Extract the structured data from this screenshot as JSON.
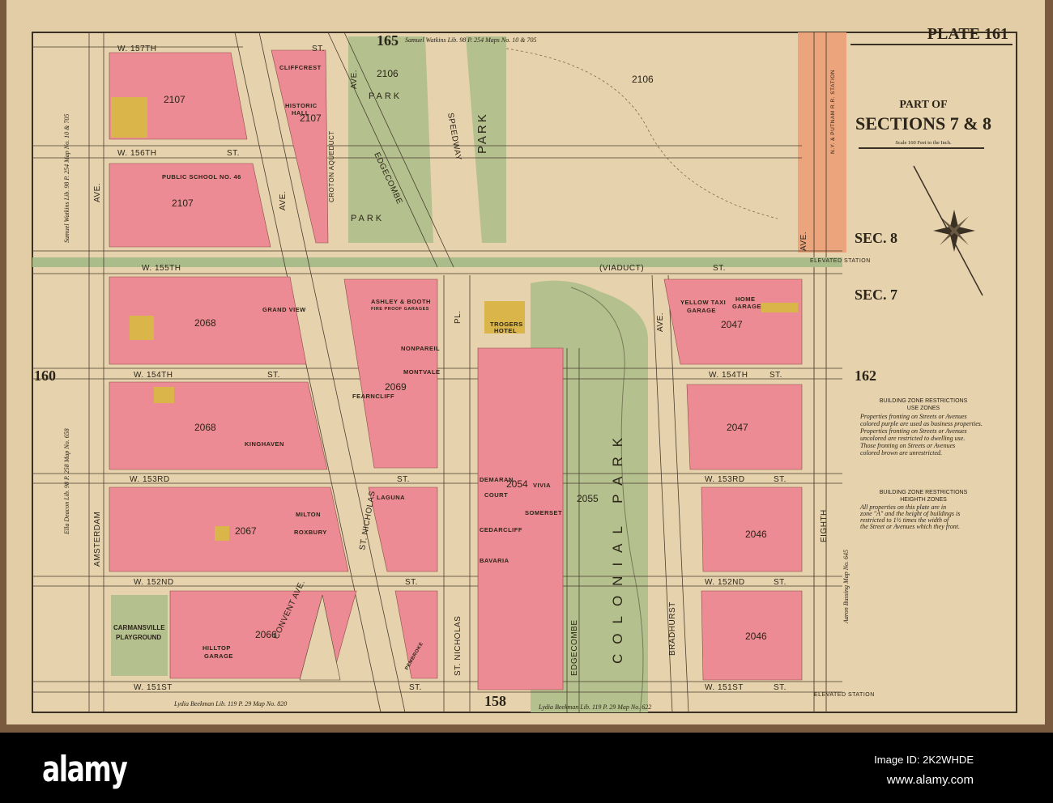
{
  "header": {
    "plate": "PLATE 161",
    "title_line1": "PART OF",
    "title_line2": "SECTIONS 7 & 8",
    "scale": "Scale 160 Feet to the Inch.",
    "sec8": "SEC. 8",
    "sec7": "SEC. 7"
  },
  "adjacent_plates": {
    "top": "165",
    "left": "160",
    "right": "162",
    "bottom": "158"
  },
  "legend": {
    "use_heading": "BUILDING ZONE RESTRICTIONS",
    "use_sub": "USE ZONES",
    "use_text": [
      "Properties fronting on Streets or Avenues",
      "colored purple are used as business properties.",
      "Properties fronting on Streets or Avenues",
      "uncolored are restricted to dwelling use.",
      "Those fronting on Streets or Avenues",
      "colored brown are unrestricted."
    ],
    "height_heading": "BUILDING ZONE RESTRICTIONS",
    "height_sub": "HEIGHTH ZONES",
    "height_text": [
      "All properties on this plate are in",
      "zone \"A\" and the height of buildings is",
      "restricted to 1½ times the width of",
      "the Street or Avenues which they front."
    ]
  },
  "streets": {
    "w157": "W. 157TH",
    "w156": "W. 156TH",
    "w155": "W. 155TH",
    "w154": "W. 154TH",
    "w153": "W. 153RD",
    "w152": "W. 152ND",
    "w151": "W. 151ST",
    "st": "ST.",
    "amsterdam": "AMSTERDAM",
    "ave": "AVE.",
    "st_nicholas": "ST. NICHOLAS",
    "edgecombe": "EDGECOMBE",
    "speedway": "SPEEDWAY",
    "pl": "PL.",
    "bradhurst": "BRADHURST",
    "eighth": "EIGHTH",
    "convent": "CONVENT AVE.",
    "croton": "CROTON AQUEDUCT",
    "viaduct": "(VIADUCT)",
    "elevated_station": "ELEVATED STATION",
    "putnam": "N.Y. & PUTNAM R.R. STATION"
  },
  "blocks": [
    "2107",
    "2106",
    "2068",
    "2069",
    "2067",
    "2066",
    "2054",
    "2055",
    "2047",
    "2046"
  ],
  "parks": {
    "park": "PARK",
    "colonial": "COLONIAL PARK",
    "playground1": "CARMANSVILLE",
    "playground2": "PLAYGROUND"
  },
  "buildings": {
    "cliffcrest": "CLIFFCREST",
    "historic1": "HISTORIC",
    "historic2": "HALL",
    "school": "PUBLIC SCHOOL NO. 46",
    "grandview": "GRAND VIEW",
    "ashley1": "ASHLEY & BOOTH",
    "ashley2": "FIRE PROOF GARAGES",
    "nonpareil": "NONPAREIL",
    "montvale": "MONTVALE",
    "fearncliff": "FEARNCLIFF",
    "trogers1": "TROGERS",
    "trogers2": "HOTEL",
    "kinghaven": "KINGHAVEN",
    "laguna": "LAGUNA",
    "milton": "MILTON",
    "roxbury": "ROXBURY",
    "yellowtaxi1": "YELLOW TAXI",
    "yellowtaxi2": "GARAGE",
    "home1": "HOME",
    "home2": "GARAGE",
    "demaran1": "DEMARAN",
    "demaran2": "COURT",
    "vivia": "VIVIA",
    "somerset": "SOMERSET",
    "cedarcliff": "CEDARCLIFF",
    "bavaria": "BAVARIA",
    "hilltop1": "HILLTOP",
    "hilltop2": "GARAGE",
    "pembroke": "PEMBROKE"
  },
  "owners": {
    "top": "Samuel Watkins  Lib. 98  P. 254  Maps No. 10 & 705",
    "left_top": "Samuel Watkins  Lib. 98  P. 254  Map No. 10 & 705",
    "left_mid": "Ella Deacon  Lib. 98  P. 258  Map No. 658",
    "bottom_left": "Lydia Beekman  Lib. 119  P. 29  Map No. 820",
    "bottom_mid": "Lydia Beekman  Lib. 119  P. 29  Map No. 622",
    "right": "Aaron Bussing  Map No. 645"
  },
  "colors": {
    "paper": "#e2cda6",
    "pink": "#ec8b93",
    "park": "#b4c08e",
    "yellow": "#d9b54a",
    "elevated": "#eba47c"
  },
  "footer": {
    "logo": "alamy",
    "image_id": "Image ID: 2K2WHDE",
    "site": "www.alamy.com"
  }
}
